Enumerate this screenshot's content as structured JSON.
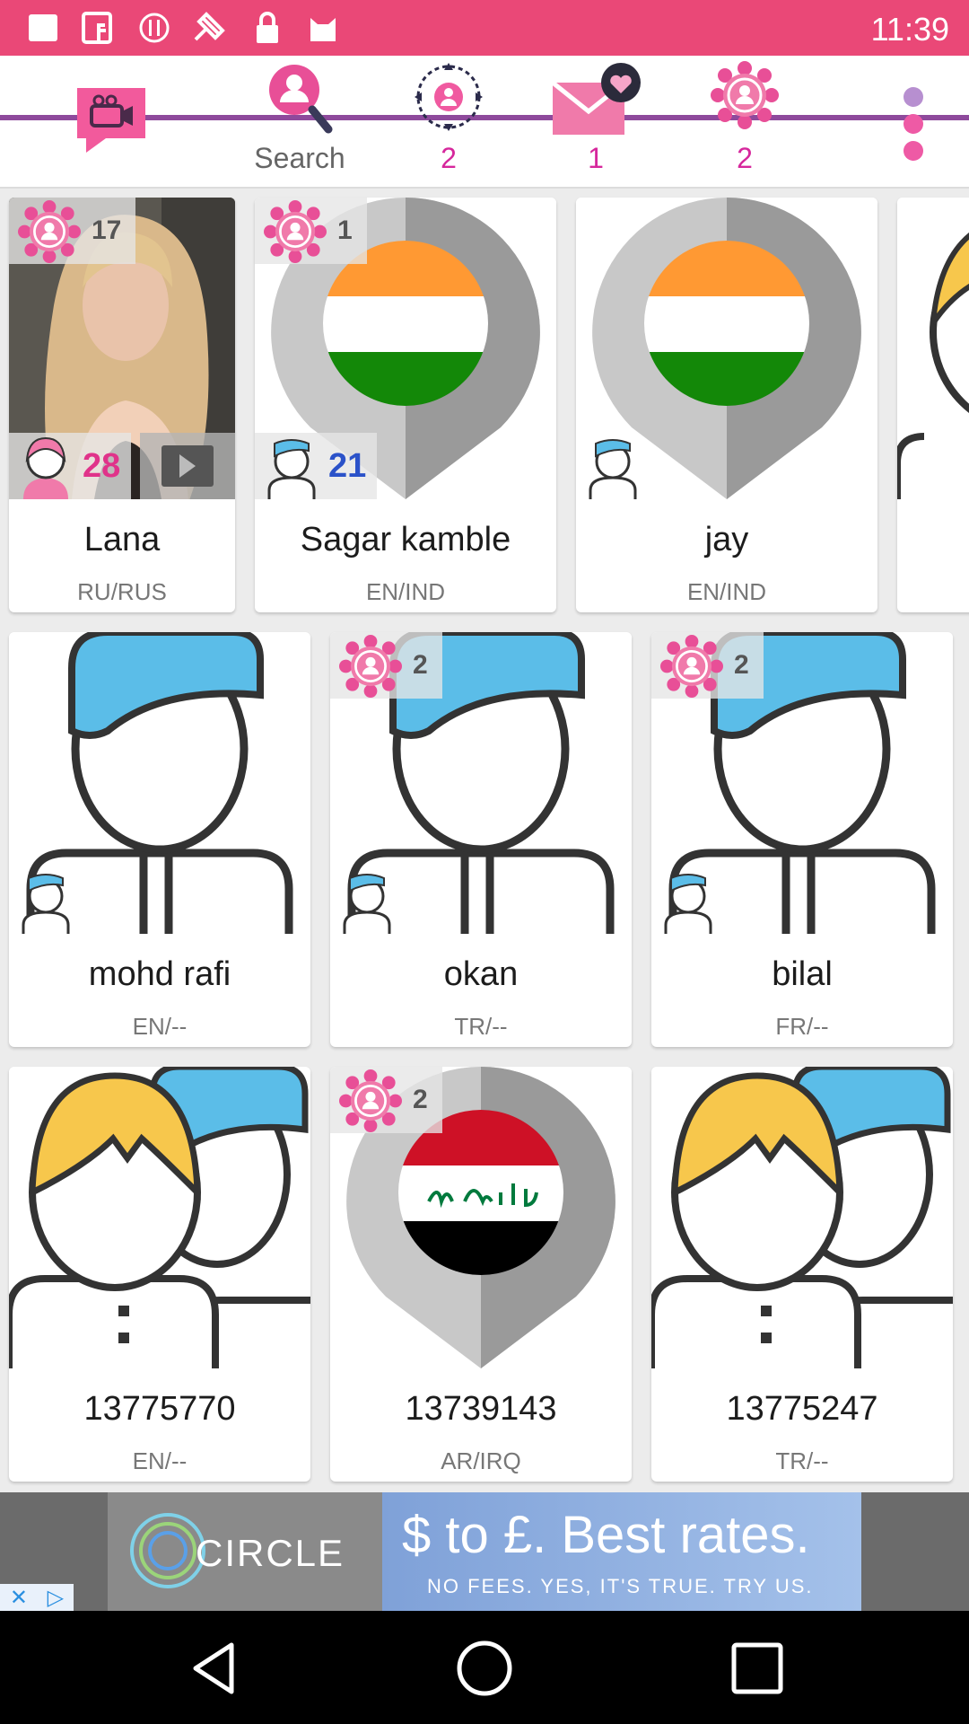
{
  "status_bar": {
    "time": "11:39",
    "icons": [
      "picture-icon",
      "facebook-icon",
      "alert-icon",
      "satellite-icon",
      "lock-icon",
      "cat-icon"
    ]
  },
  "toolbar": {
    "accent": "#8e4a9c",
    "items": [
      {
        "name": "video-chat",
        "label": ""
      },
      {
        "name": "search",
        "label": "Search"
      },
      {
        "name": "nearby",
        "label": "2"
      },
      {
        "name": "messages",
        "label": "1"
      },
      {
        "name": "network",
        "label": "2"
      },
      {
        "name": "more",
        "label": ""
      }
    ]
  },
  "profiles": [
    {
      "name": "Lana",
      "lang": "RU/RUS",
      "badge": "17",
      "age": "28",
      "gender": "female",
      "picture": "photo",
      "video": true
    },
    {
      "name": "Sagar kamble",
      "lang": "EN/IND",
      "badge": "1",
      "age": "21",
      "gender": "male",
      "picture": "flag-india"
    },
    {
      "name": "jay",
      "lang": "EN/IND",
      "badge": "",
      "age": "",
      "gender": "male",
      "picture": "flag-india"
    },
    {
      "name": "mohd rafi",
      "lang": "EN/--",
      "badge": "",
      "age": "",
      "gender": "male",
      "picture": "avatar-male"
    },
    {
      "name": "okan",
      "lang": "TR/--",
      "badge": "2",
      "age": "",
      "gender": "male",
      "picture": "avatar-male"
    },
    {
      "name": "bilal",
      "lang": "FR/--",
      "badge": "2",
      "age": "",
      "gender": "male",
      "picture": "avatar-male"
    },
    {
      "name": "13775770",
      "lang": "EN/--",
      "badge": "",
      "picture": "avatar-couple"
    },
    {
      "name": "13739143",
      "lang": "AR/IRQ",
      "badge": "2",
      "picture": "flag-iraq"
    },
    {
      "name": "13775247",
      "lang": "TR/--",
      "badge": "",
      "picture": "avatar-couple"
    }
  ],
  "ad": {
    "brand": "CIRCLE",
    "headline": "$ to £. Best rates.",
    "subline": "NO FEES. YES, IT'S TRUE. TRY US."
  },
  "navbar": [
    "back-icon",
    "home-icon",
    "recents-icon"
  ]
}
